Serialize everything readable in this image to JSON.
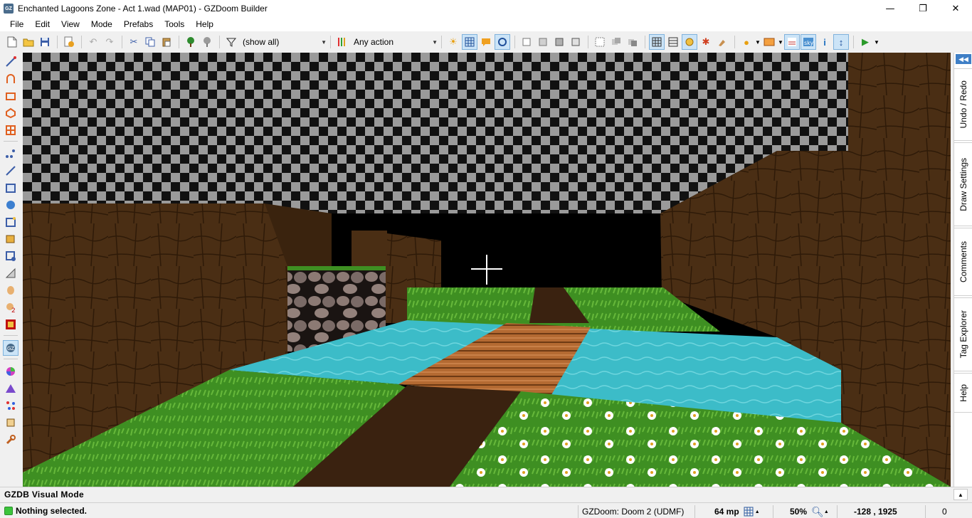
{
  "window": {
    "title": "Enchanted Lagoons Zone - Act 1.wad (MAP01) - GZDoom Builder",
    "app_icon": "GZ",
    "controls": {
      "minimize": "—",
      "maximize": "❐",
      "close": "✕"
    }
  },
  "menu": [
    "File",
    "Edit",
    "View",
    "Mode",
    "Prefabs",
    "Tools",
    "Help"
  ],
  "toolbar": {
    "filter_value": "(show all)",
    "action_value": "Any action"
  },
  "dock_tabs": [
    "Undo / Redo",
    "Draw Settings",
    "Comments",
    "Tag Explorer",
    "Help"
  ],
  "modebar": {
    "mode": "GZDB Visual Mode"
  },
  "status": {
    "message": "Nothing selected.",
    "engine": "GZDoom: Doom 2 (UDMF)",
    "grid": "64 mp",
    "zoom": "50%",
    "coords": "-128 , 1925",
    "extra": "0"
  },
  "colors": {
    "accent": "#3f7fc6",
    "status_ok": "#3cc43c",
    "water": "#3cbcc8",
    "grass": "#3e8f22",
    "dirt": "#4a2e14",
    "ceiling_light": "#9a9a9a",
    "ceiling_dark": "#0c0c0c"
  }
}
